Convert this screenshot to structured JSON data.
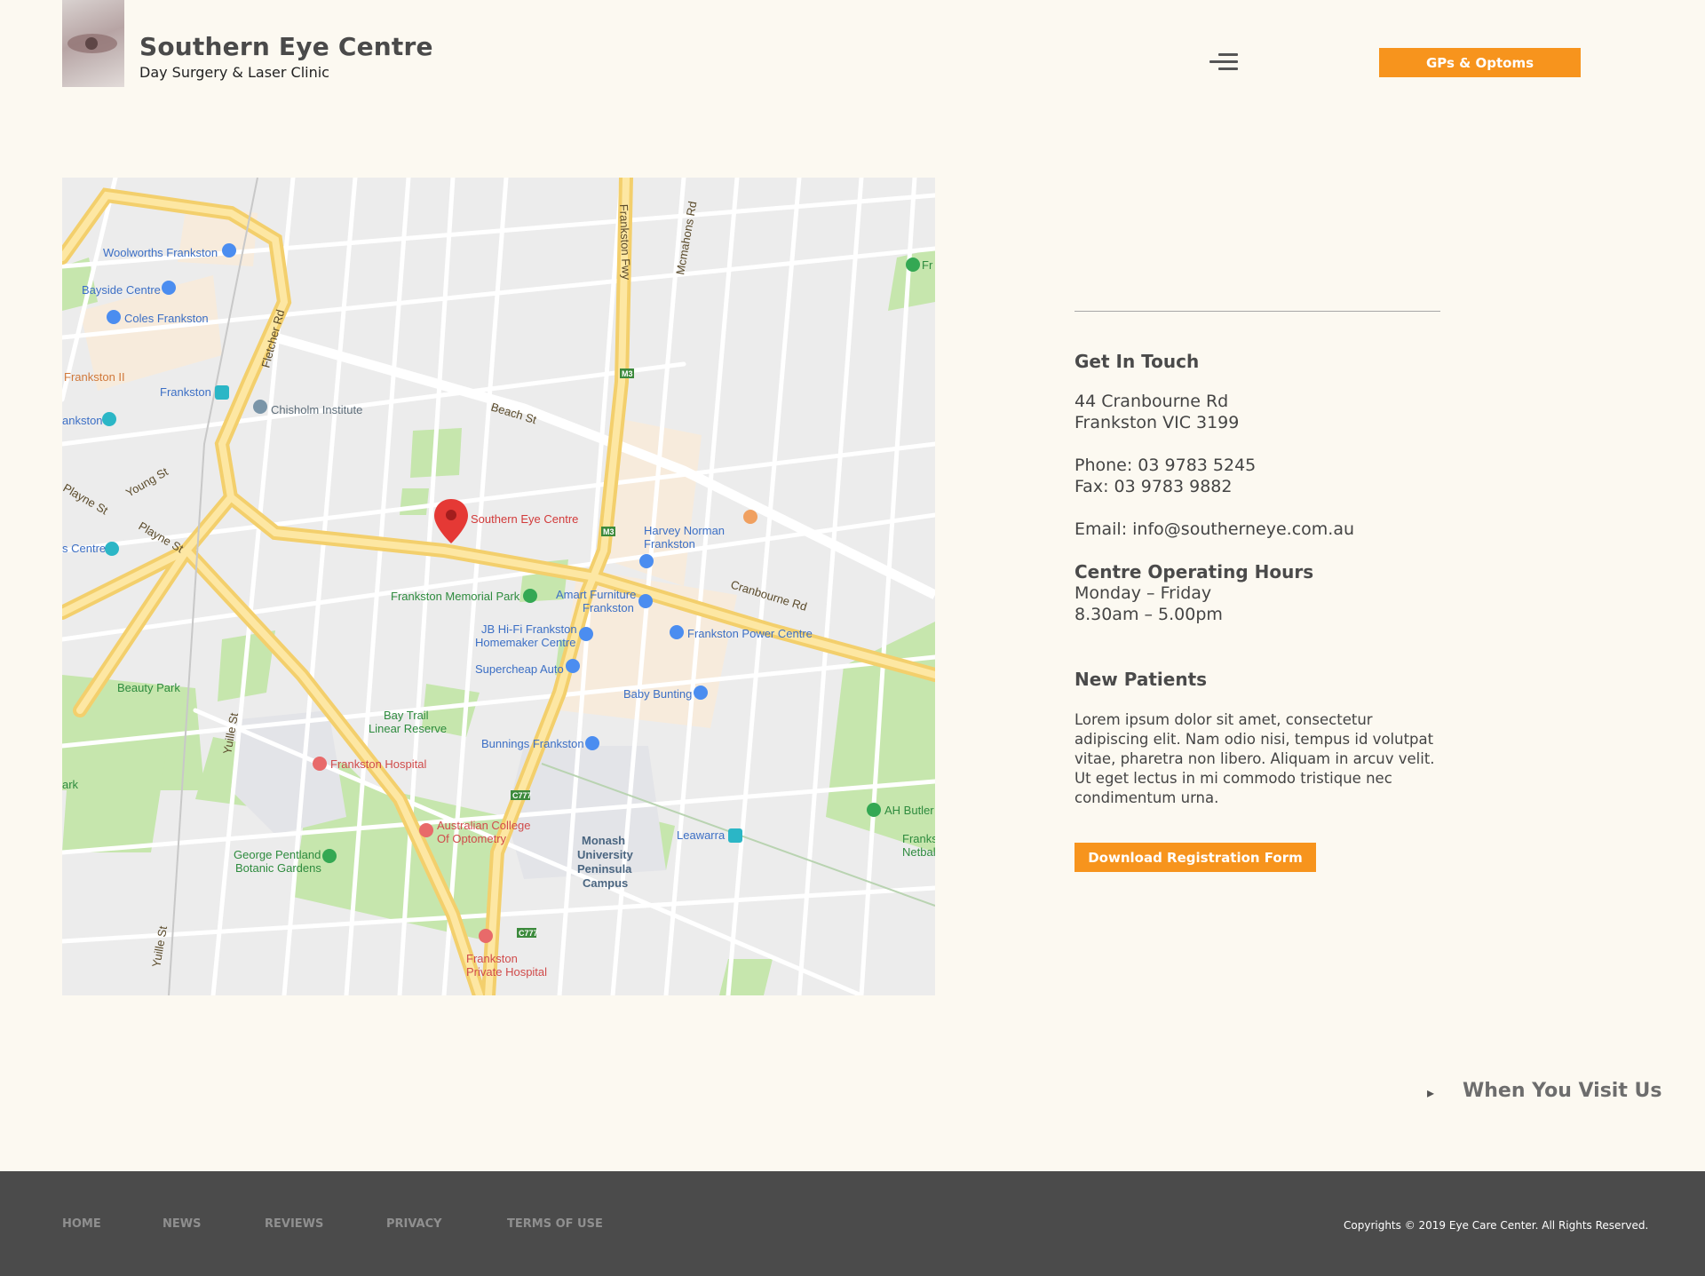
{
  "header": {
    "brand_title": "Southern Eye Centre",
    "brand_subtitle": "Day Surgery & Laser Clinic",
    "logo_icon": "eye-logo",
    "menu_icon": "hamburger-menu-icon",
    "gp_button_label": "GPs & Optoms"
  },
  "map": {
    "pin_label": "Southern Eye Centre",
    "labels": {
      "woolworths": "Woolworths Frankston",
      "bayside": "Bayside Centre",
      "coles": "Coles Frankston",
      "frankston2": "Frankston II",
      "frankston_station": "Frankston",
      "chisholm": "Chisholm Institute",
      "ankston": "ankston",
      "s_centre": "s Centre",
      "harvey_l1": "Harvey Norman",
      "harvey_l2": "Frankston",
      "memorial": "Frankston Memorial Park",
      "amart_l1": "Amart Furniture",
      "amart_l2": "Frankston",
      "jbhifi_l1": "JB Hi-Fi Frankston",
      "jbhifi_l2": "Homemaker Centre",
      "power": "Frankston Power Centre",
      "supercheap": "Supercheap Auto",
      "baby_bunting": "Baby Bunting",
      "beauty_park": "Beauty Park",
      "bay_trail_l1": "Bay Trail",
      "bay_trail_l2": "Linear Reserve",
      "bunnings": "Bunnings Frankston",
      "hospital": "Frankston Hospital",
      "acoo_l1": "Australian College",
      "acoo_l2": "Of Optometry",
      "monash_l1": "Monash",
      "monash_l2": "University",
      "monash_l3": "Peninsula",
      "monash_l4": "Campus",
      "leawarra": "Leawarra",
      "botanic_l1": "George Pentland",
      "botanic_l2": "Botanic Gardens",
      "private_l1": "Frankston",
      "private_l2": "Private Hospital",
      "ah_butler": "AH Butler",
      "franks": "Franks",
      "netba": "Netbal",
      "fr": "Fr",
      "ark": "ark"
    },
    "roads": {
      "fletcher": "Fletcher Rd",
      "beach": "Beach St",
      "cranbourne": "Cranbourne Rd",
      "frankston_fwy": "Frankston Fwy",
      "mcmahons": "Mcmahons Rd",
      "young": "Young St",
      "playne": "Playne St",
      "playne2": "Playne St",
      "yuille": "Yuille St",
      "yuille2": "Yuille St"
    }
  },
  "contact": {
    "heading": "Get In Touch",
    "address_line1": "44 Cranbourne Rd",
    "address_line2": "Frankston VIC 3199",
    "phone": "Phone: 03 9783 5245",
    "fax": "Fax: 03 9783 9882",
    "email": "Email: info@southerneye.com.au",
    "hours_heading": "Centre Operating Hours",
    "hours_days": "Monday – Friday",
    "hours_times": "8.30am – 5.00pm"
  },
  "new_patients": {
    "heading": "New Patients",
    "body": "Lorem ipsum dolor sit amet, consectetur adipiscing elit. Nam odio nisi, tempus id volutpat vitae, pharetra non libero. Aliquam in arcuv velit. Ut eget lectus in mi commodo tristique nec condimentum urna.",
    "button_label": "Download Registration Form"
  },
  "visit": {
    "arrow": "▸",
    "label": "When You Visit Us"
  },
  "footer": {
    "links": [
      "HOME",
      "NEWS",
      "REVIEWS",
      "PRIVACY",
      "TERMS OF USE"
    ],
    "copyright": "Copyrights © 2019 Eye Care Center. All Rights Reserved."
  },
  "colors": {
    "background": "#fcf9f1",
    "accent": "#f7941d",
    "footer": "#4b4b4b",
    "map_road_major": "#fbd87a",
    "map_park": "#bfe3a4",
    "map_pin": "#e53935"
  }
}
